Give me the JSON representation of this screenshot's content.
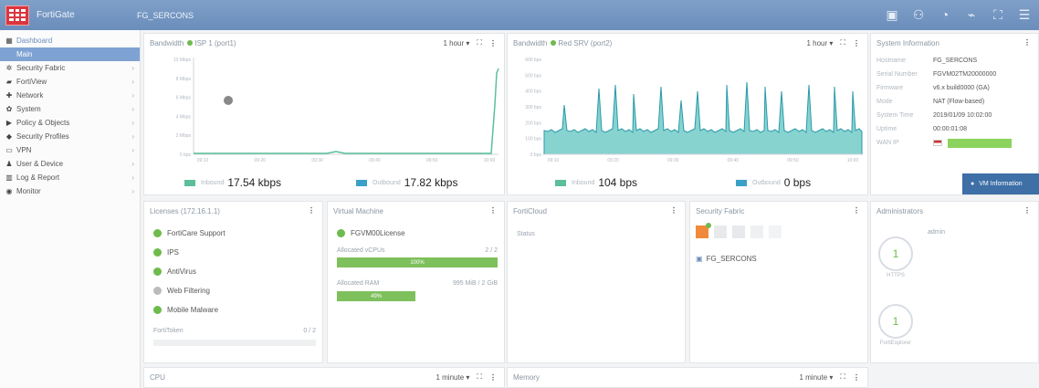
{
  "header": {
    "app_name": "FortiGate",
    "hostname": "FG_SERCONS",
    "icons": [
      "monitor-icon",
      "user-icon",
      "bell-icon",
      "terminal-icon",
      "fullscreen-icon",
      "admin-icon"
    ]
  },
  "sidebar": {
    "items": [
      {
        "label": "Dashboard",
        "icon": "dashboard-icon",
        "sub": true
      },
      {
        "label": "Main",
        "active": true
      },
      {
        "label": "Security Fabric",
        "icon": "fabric-icon"
      },
      {
        "label": "FortiView",
        "icon": "fortiview-icon"
      },
      {
        "label": "Network",
        "icon": "network-icon"
      },
      {
        "label": "System",
        "icon": "system-icon"
      },
      {
        "label": "Policy & Objects",
        "icon": "policy-icon"
      },
      {
        "label": "Security Profiles",
        "icon": "shield-icon"
      },
      {
        "label": "VPN",
        "icon": "vpn-icon"
      },
      {
        "label": "User & Device",
        "icon": "user-icon"
      },
      {
        "label": "Log & Report",
        "icon": "log-icon"
      },
      {
        "label": "Monitor",
        "icon": "monitor-icon"
      }
    ]
  },
  "bandwidth1": {
    "title": "Bandwidth",
    "interface": "ISP 1 (port1)",
    "range": "1 hour ▾",
    "inbound_value": "17.54 kbps",
    "outbound_value": "17.82 kbps",
    "inbound_label": "Inbound",
    "outbound_label": "Outbound",
    "inbound_color": "#5cbf9a",
    "outbound_color": "#3aa0c8",
    "y_ticks": [
      "10 Mbps",
      "8 Mbps",
      "6 Mbps",
      "4 Mbps",
      "2 Mbps",
      "0 bps"
    ],
    "x_ticks": [
      "09:10",
      "09:20",
      "09:30",
      "09:40",
      "09:50",
      "10:00"
    ]
  },
  "bandwidth2": {
    "title": "Bandwidth",
    "interface": "Red SRV (port2)",
    "range": "1 hour ▾",
    "inbound_value": "104 bps",
    "outbound_value": "0 bps",
    "inbound_label": "Inbound",
    "outbound_label": "Outbound",
    "y_ticks": [
      "600 bps",
      "500 bps",
      "400 bps",
      "300 bps",
      "200 bps",
      "100 bps",
      "0 bps"
    ],
    "x_ticks": [
      "09:10",
      "09:20",
      "09:30",
      "09:40",
      "09:50",
      "10:00"
    ]
  },
  "sysinfo": {
    "title": "System Information",
    "rows": [
      {
        "k": "Hostname",
        "v": "FG_SERCONS"
      },
      {
        "k": "Serial Number",
        "v": "FGVM02TM20000000"
      },
      {
        "k": "Firmware",
        "v": "v6.x build0000 (GA)"
      },
      {
        "k": "Mode",
        "v": "NAT (Flow-based)"
      },
      {
        "k": "System Time",
        "v": "2019/01/09 10:02:00"
      },
      {
        "k": "Uptime",
        "v": "00:00:01:08"
      },
      {
        "k": "WAN IP",
        "v": ""
      }
    ],
    "tooltip": "VM Information"
  },
  "licenses": {
    "title": "Licenses",
    "ip": "(172.16.1.1)",
    "items": [
      {
        "label": "FortiCare Support",
        "ok": true
      },
      {
        "label": "IPS",
        "ok": true
      },
      {
        "label": "AntiVirus",
        "ok": true
      },
      {
        "label": "Web Filtering",
        "ok": false
      },
      {
        "label": "Mobile Malware",
        "ok": true
      }
    ],
    "foot_label": "FortiToken",
    "foot_value": "0 / 2"
  },
  "vm": {
    "title": "Virtual Machine",
    "license": "FGVM00License",
    "cpu_label": "Allocated vCPUs",
    "cpu_value": "2 / 2",
    "cpu_pct": "100%",
    "cpu_fraction": 1.0,
    "ram_label": "Allocated RAM",
    "ram_value": "995 MiB / 2 GiB",
    "ram_pct": "49%",
    "ram_fraction": 0.49
  },
  "forticloud": {
    "title": "FortiCloud",
    "status": "Status"
  },
  "fabric": {
    "title": "Security Fabric",
    "device": "FG_SERCONS"
  },
  "admins": {
    "title": "Administrators",
    "user": "admin",
    "count_a": "1",
    "count_a_label": "HTTPS",
    "count_b": "1",
    "count_b_label": "FortiExplorer"
  },
  "bottom": {
    "cpu_title": "CPU",
    "cpu_range": "1 minute ▾",
    "mem_title": "Memory",
    "mem_range": "1 minute ▾"
  }
}
